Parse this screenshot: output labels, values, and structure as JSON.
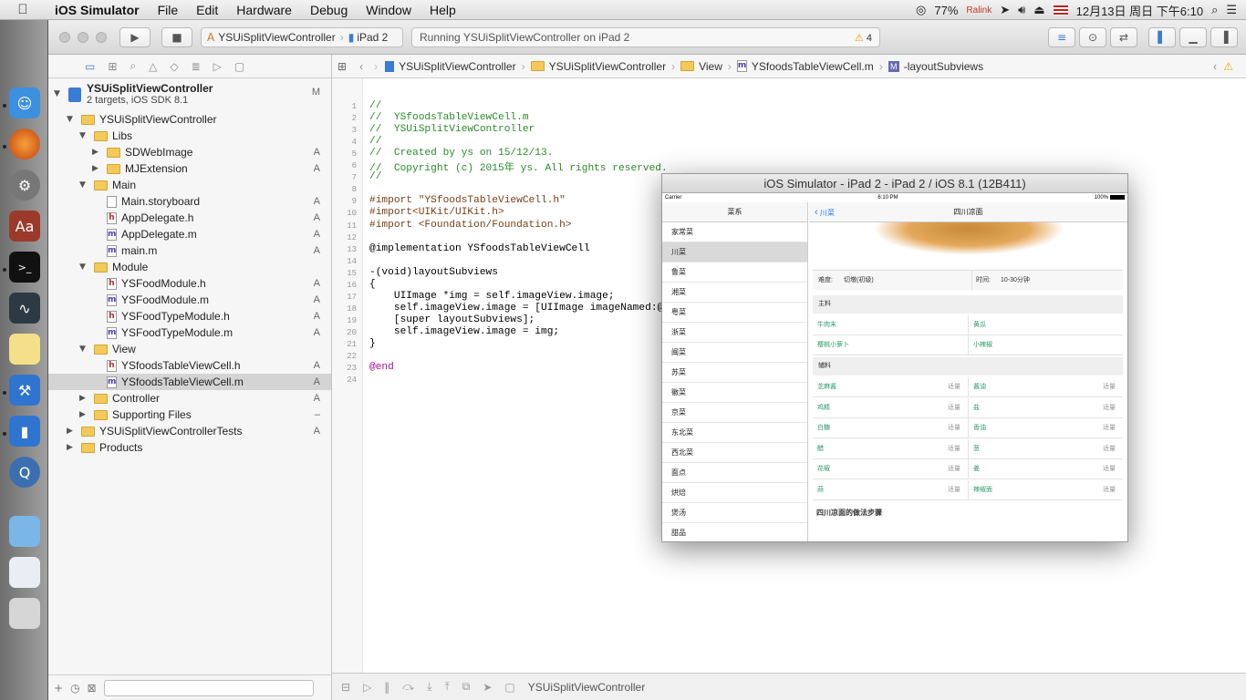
{
  "menubar": {
    "app": "iOS Simulator",
    "items": [
      "File",
      "Edit",
      "Hardware",
      "Debug",
      "Window",
      "Help"
    ],
    "battery": "77%",
    "network": "Ralink",
    "datetime": "12月13日 周日 下午6:10"
  },
  "toolbar": {
    "scheme": "YSUiSplitViewController",
    "device": "iPad 2",
    "activity": "Running YSUiSplitViewController on iPad 2",
    "warnings": "4"
  },
  "navigator": {
    "project": "YSUiSplitViewController",
    "project_sub": "2 targets, iOS SDK 8.1",
    "project_badge": "M",
    "items": [
      {
        "label": "YSUiSplitViewController",
        "type": "folder",
        "badge": ""
      },
      {
        "label": "Libs",
        "type": "folder",
        "badge": ""
      },
      {
        "label": "SDWebImage",
        "type": "folder",
        "badge": "A"
      },
      {
        "label": "MJExtension",
        "type": "folder",
        "badge": "A"
      },
      {
        "label": "Main",
        "type": "folder",
        "badge": ""
      },
      {
        "label": "Main.storyboard",
        "type": "file",
        "icon": "",
        "badge": "A"
      },
      {
        "label": "AppDelegate.h",
        "type": "file",
        "icon": "h",
        "badge": "A"
      },
      {
        "label": "AppDelegate.m",
        "type": "file",
        "icon": "m",
        "badge": "A"
      },
      {
        "label": "main.m",
        "type": "file",
        "icon": "m",
        "badge": "A"
      },
      {
        "label": "Module",
        "type": "folder",
        "badge": ""
      },
      {
        "label": "YSFoodModule.h",
        "type": "file",
        "icon": "h",
        "badge": "A"
      },
      {
        "label": "YSFoodModule.m",
        "type": "file",
        "icon": "m",
        "badge": "A"
      },
      {
        "label": "YSFoodTypeModule.h",
        "type": "file",
        "icon": "h",
        "badge": "A"
      },
      {
        "label": "YSFoodTypeModule.m",
        "type": "file",
        "icon": "m",
        "badge": "A"
      },
      {
        "label": "View",
        "type": "folder",
        "badge": ""
      },
      {
        "label": "YSfoodsTableViewCell.h",
        "type": "file",
        "icon": "h",
        "badge": "A"
      },
      {
        "label": "YSfoodsTableViewCell.m",
        "type": "file",
        "icon": "m",
        "badge": "A"
      },
      {
        "label": "Controller",
        "type": "folder",
        "badge": "A"
      },
      {
        "label": "Supporting Files",
        "type": "folder",
        "badge": "–"
      },
      {
        "label": "YSUiSplitViewControllerTests",
        "type": "folder",
        "badge": "A"
      },
      {
        "label": "Products",
        "type": "folder",
        "badge": ""
      }
    ]
  },
  "jumpbar": {
    "crumbs": [
      "YSUiSplitViewController",
      "YSUiSplitViewController",
      "View",
      "YSfoodsTableViewCell.m",
      "-layoutSubviews"
    ]
  },
  "editor": {
    "line_numbers": [
      "1",
      "2",
      "3",
      "4",
      "5",
      "6",
      "7",
      "8",
      "9",
      "10",
      "11",
      "12",
      "13",
      "14",
      "15",
      "16",
      "17",
      "18",
      "19",
      "20",
      "21",
      "22",
      "23",
      "24"
    ],
    "lines": [
      "//",
      "//  YSfoodsTableViewCell.m",
      "//  YSUiSplitViewController",
      "//",
      "//  Created by ys on 15/12/13.",
      "//  Copyright (c) 2015年 ys. All rights reserved.",
      "//",
      "",
      "#import \"YSfoodsTableViewCell.h\"",
      "#import<UIKit/UIKit.h>",
      "#import <Foundation/Foundation.h>",
      "",
      "@implementation YSfoodsTableViewCell",
      "",
      "-(void)layoutSubviews",
      "{",
      "    UIImage *img = self.imageView.image;",
      "    self.imageView.image = [UIImage imageNamed:@",
      "    [super layoutSubviews];",
      "    self.imageView.image = img;",
      "}",
      "",
      "@end",
      ""
    ]
  },
  "debugbar": {
    "target": "YSUiSplitViewController"
  },
  "simulator": {
    "title": "iOS Simulator - iPad 2 - iPad 2 / iOS 8.1 (12B411)",
    "carrier": "Carrier",
    "time": "6:10 PM",
    "battery": "100%",
    "master_title": "菜系",
    "categories": [
      "家常菜",
      "川菜",
      "鲁菜",
      "湘菜",
      "粤菜",
      "浙菜",
      "闽菜",
      "苏菜",
      "徽菜",
      "京菜",
      "东北菜",
      "西北菜",
      "面点",
      "烘焙",
      "煲汤",
      "甜品"
    ],
    "selected_category": 1,
    "back_label": "川菜",
    "detail_title": "四川凉面",
    "difficulty_label": "难度:",
    "difficulty_value": "切墩(初级)",
    "time_label": "时间:",
    "time_value": "10-30分钟",
    "main_label": "主料",
    "main_items": [
      [
        "牛肉末",
        "黄瓜"
      ],
      [
        "樱桃小萝卜",
        "小辣椒"
      ]
    ],
    "aux_label": "辅料",
    "aux_items": [
      [
        "芝麻酱",
        "适量",
        "酱油",
        "适量"
      ],
      [
        "鸡精",
        "适量",
        "盐",
        "适量"
      ],
      [
        "白糖",
        "适量",
        "香油",
        "适量"
      ],
      [
        "醋",
        "适量",
        "葱",
        "适量"
      ],
      [
        "花椒",
        "适量",
        "姜",
        "适量"
      ],
      [
        "蒜",
        "适量",
        "辣椒面",
        "适量"
      ]
    ],
    "steps_title": "四川凉面的做法步骤"
  }
}
